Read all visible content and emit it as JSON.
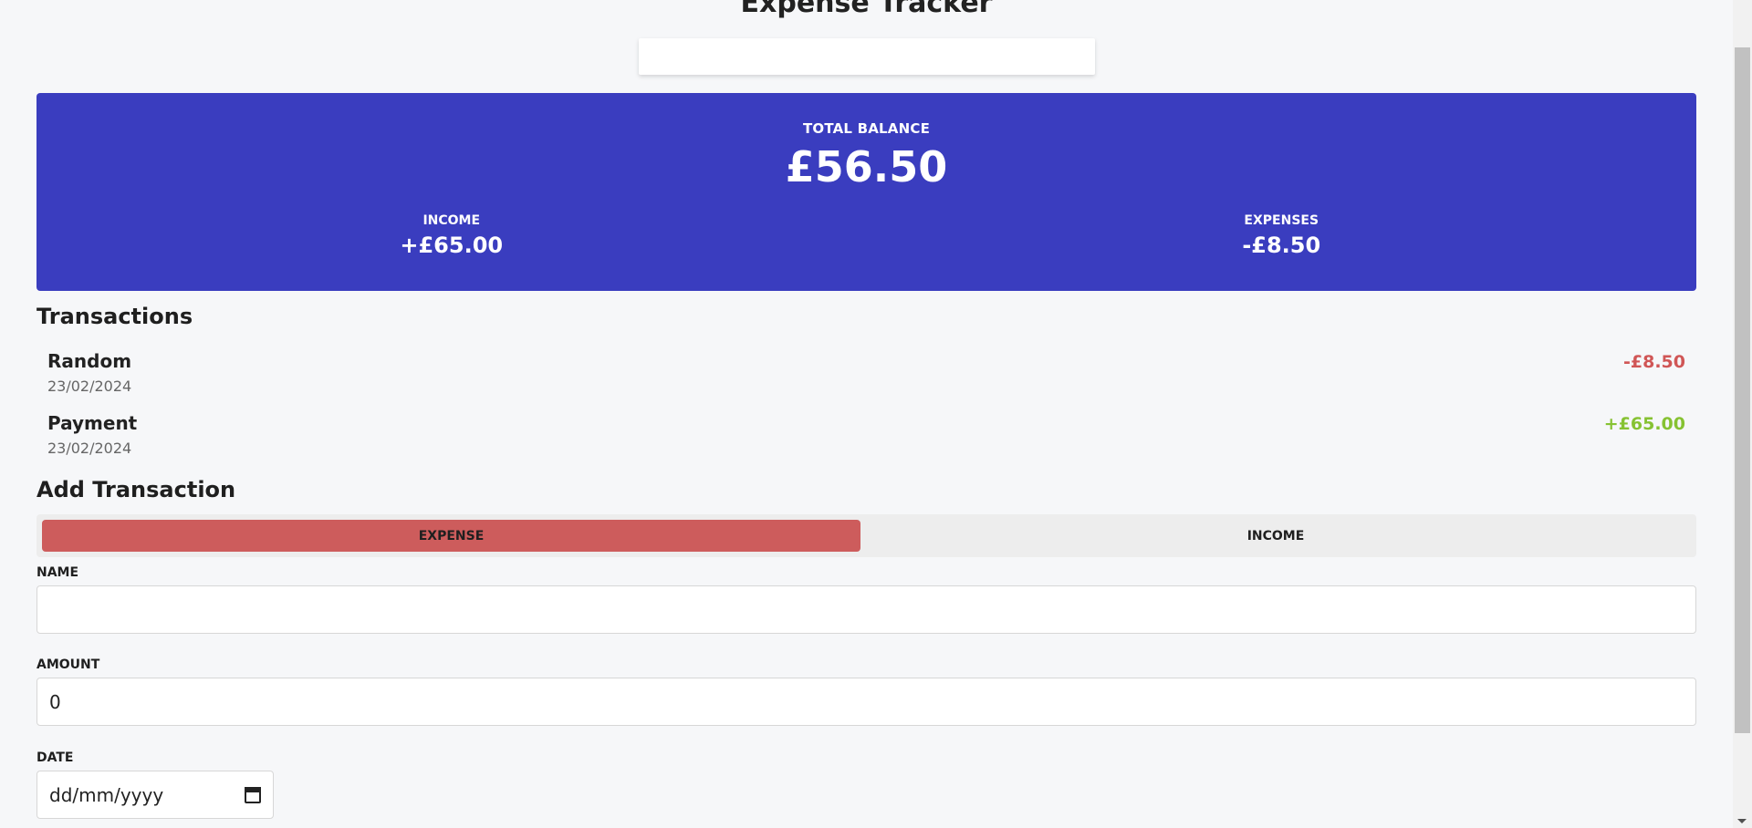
{
  "app": {
    "title": "Expense Tracker"
  },
  "balance": {
    "label": "TOTAL BALANCE",
    "amount": "£56.50",
    "income_label": "INCOME",
    "income_amount": "+£65.00",
    "expenses_label": "EXPENSES",
    "expenses_amount": "-£8.50"
  },
  "transactions": {
    "title": "Transactions",
    "items": [
      {
        "name": "Random",
        "date": "23/02/2024",
        "amount": "-£8.50",
        "type": "expense"
      },
      {
        "name": "Payment",
        "date": "23/02/2024",
        "amount": "+£65.00",
        "type": "income"
      }
    ]
  },
  "add_transaction": {
    "title": "Add Transaction",
    "toggle": {
      "expense_label": "EXPENSE",
      "income_label": "INCOME",
      "selected": "expense"
    },
    "name_label": "NAME",
    "name_value": "",
    "amount_label": "AMOUNT",
    "amount_value": "0",
    "date_label": "DATE",
    "date_placeholder": "dd/mm/yyyy"
  },
  "colors": {
    "card": "#3a3dbf",
    "expense": "#d05656",
    "income": "#86c232",
    "toggle_active": "#cd5c5c"
  }
}
